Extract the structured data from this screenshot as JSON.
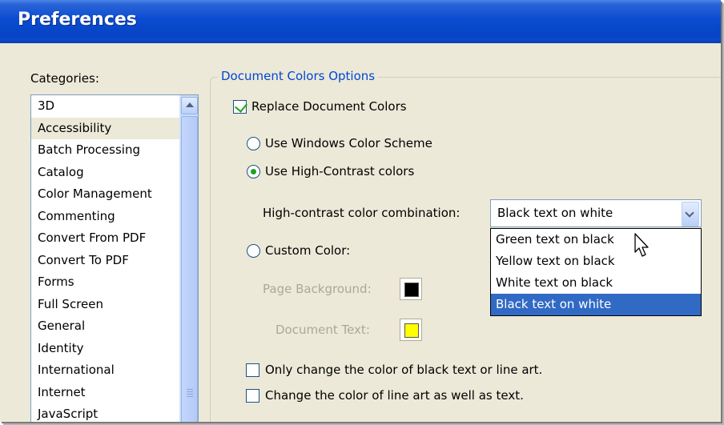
{
  "window": {
    "title": "Preferences"
  },
  "categories": {
    "label": "Categories:",
    "items": [
      "3D",
      "Accessibility",
      "Batch Processing",
      "Catalog",
      "Color Management",
      "Commenting",
      "Convert From PDF",
      "Convert To PDF",
      "Forms",
      "Full Screen",
      "General",
      "Identity",
      "International",
      "Internet",
      "JavaScript"
    ],
    "selected": "Accessibility"
  },
  "group": {
    "title": "Document Colors Options"
  },
  "replace_colors": {
    "label": "Replace Document Colors",
    "checked": true
  },
  "options": {
    "windows_scheme": {
      "label": "Use Windows Color Scheme",
      "selected": false
    },
    "high_contrast": {
      "label": "Use High-Contrast colors",
      "selected": true
    },
    "custom_color": {
      "label": "Custom Color:",
      "selected": false
    }
  },
  "combination": {
    "label": "High-contrast color combination:",
    "value": "Black text on white",
    "options": [
      "Green text on black",
      "Yellow text on black",
      "White text on black",
      "Black text on white"
    ],
    "highlighted": "Black text on white"
  },
  "custom": {
    "page_background_label": "Page Background:",
    "page_background_color": "#000000",
    "document_text_label": "Document Text:",
    "document_text_color": "#ffff00"
  },
  "only_black_text": {
    "label": "Only change the color of black text or line art.",
    "checked": false
  },
  "line_art": {
    "label": "Change the color of line art as well as text.",
    "checked": false
  },
  "icons": [
    "checkbox-checked-icon",
    "radio-selected-icon",
    "scroll-up-arrow-icon",
    "dropdown-arrow-icon",
    "mouse-pointer-icon"
  ]
}
